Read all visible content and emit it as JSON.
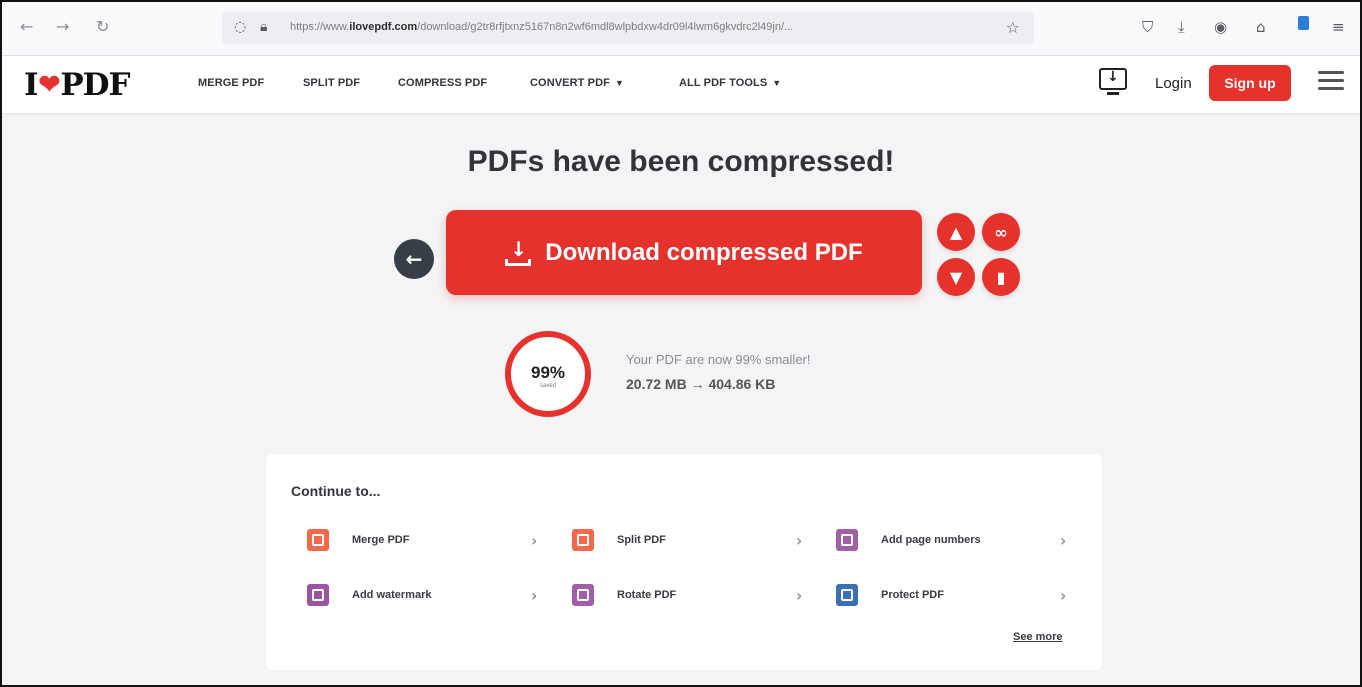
{
  "browser": {
    "url_prefix": "https://www.",
    "url_domain": "ilovepdf.com",
    "url_path": "/download/g2tr8rfjtxnz5167n8n2wf6mdl8wlpbdxw4dr09l4lwm6gkvdrc2l49jn/..."
  },
  "header": {
    "logo_left": "I",
    "logo_right": "PDF",
    "nav": {
      "merge": "MERGE PDF",
      "split": "SPLIT PDF",
      "compress": "COMPRESS PDF",
      "convert": "CONVERT PDF",
      "all_tools": "ALL PDF TOOLS"
    },
    "login": "Login",
    "signup": "Sign up"
  },
  "main": {
    "title": "PDFs have been compressed!",
    "download_label": "Download compressed PDF",
    "ring_value": "99%",
    "ring_sub": "saved",
    "result_message": "Your PDF are now 99% smaller!",
    "result_sizes": "20.72 MB → 404.86 KB",
    "saved_fraction": 0.99
  },
  "continue": {
    "title": "Continue to...",
    "items": [
      {
        "label": "Merge PDF",
        "icon": "merge-pdf-icon",
        "color": "#f26a4b"
      },
      {
        "label": "Split PDF",
        "icon": "split-pdf-icon",
        "color": "#f26a4b"
      },
      {
        "label": "Add page numbers",
        "icon": "page-numbers-icon",
        "color": "#a05fa6"
      },
      {
        "label": "Add watermark",
        "icon": "watermark-icon",
        "color": "#9b55a0"
      },
      {
        "label": "Rotate PDF",
        "icon": "rotate-pdf-icon",
        "color": "#a05fa6"
      },
      {
        "label": "Protect PDF",
        "icon": "protect-pdf-icon",
        "color": "#3b6fb6"
      }
    ],
    "see_more": "See more"
  },
  "colors": {
    "brand_red": "#e5322d",
    "back_button": "#383e45"
  }
}
